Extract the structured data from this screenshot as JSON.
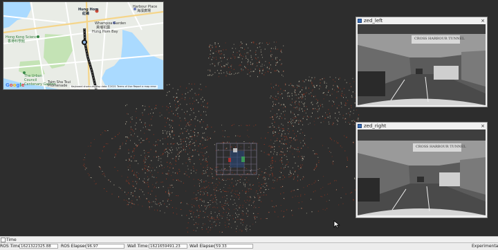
{
  "map": {
    "labels": {
      "hung_hom": "Hung Hom",
      "hung_hom_zh": "紅磡",
      "harbour_place": "Harbour Place",
      "harbour_place_zh": "海濱廣場",
      "whampoa_garden": "Whampoa Garden",
      "whampoa_garden_zh": "黃埔花園",
      "hung_hom_bay": "Hung Hom Bay",
      "hk_science_museum": "Hong Kong Science",
      "hk_science_museum_zh": "香港科學館",
      "urban_council": "The Urban",
      "urban_council_2": "Council",
      "urban_council_3": "Centenary Garden",
      "promenade": "Tsim Sha Tsui",
      "promenade_2": "Promenade"
    },
    "logo_text": "Google",
    "attribution": "Keyboard shortcuts   Map data ©2021   Terms of Use   Report a map error",
    "colors": {
      "water": "#aadaff",
      "land": "#e9ece6",
      "park": "#c4e3b5",
      "road": "#ffffff",
      "route": "#1a1a1a"
    }
  },
  "cameras": {
    "left": {
      "title": "zed_left",
      "sign": "CROSS HARBOUR TUNNEL"
    },
    "right": {
      "title": "zed_right",
      "sign": "CROSS HARBOUR TUNNEL"
    },
    "close_glyph": "×"
  },
  "timebar": {
    "label": "Time"
  },
  "status": {
    "ros_time_label": "ROS Time:",
    "ros_time_value": "1621322325.88",
    "ros_elapsed_label": "ROS Elapsed:",
    "ros_elapsed_value": "96.97",
    "wall_time_label": "Wall Time:",
    "wall_time_value": "1621659491.23",
    "wall_elapsed_label": "Wall Elapsed:",
    "wall_elapsed_value": "59.33",
    "experimental_label": "Experimental"
  },
  "colors": {
    "viewport_bg": "#2d2d2d",
    "points_red": "#a83a22",
    "points_light": "#d8d0b8",
    "grid": "#7a6a8a"
  }
}
